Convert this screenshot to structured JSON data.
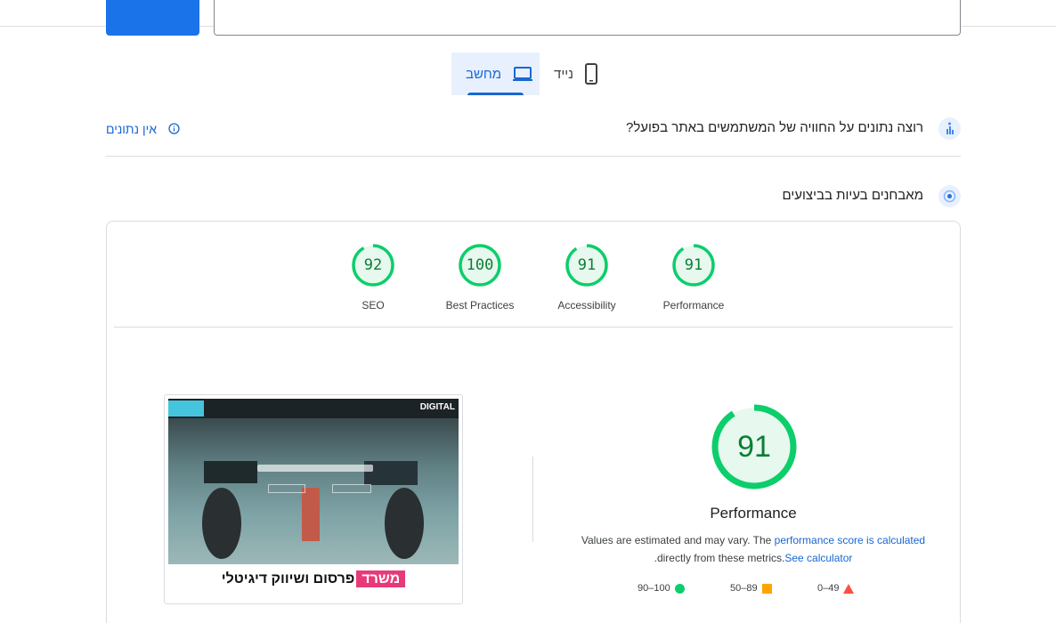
{
  "tabs": [
    {
      "label": "מחשב",
      "icon": "laptop-icon",
      "active": true
    },
    {
      "label": "נייד",
      "icon": "phone-icon",
      "active": false
    }
  ],
  "crux": {
    "question": "רוצה נתונים על החוויה של המשתמשים באתר בפועל?",
    "no_data": "אין נתונים"
  },
  "diagnose": {
    "title": "מאבחנים בעיות בביצועים"
  },
  "gauges": [
    {
      "score": 91,
      "label": "Performance"
    },
    {
      "score": 91,
      "label": "Accessibility"
    },
    {
      "score": 100,
      "label": "Best Practices"
    },
    {
      "score": 92,
      "label": "SEO"
    }
  ],
  "screenshot": {
    "caption_tag": "משרד",
    "caption": "פרסום ושיווק דיגיטלי",
    "logo": "DIGITAL"
  },
  "performance": {
    "score": 91,
    "label": "Performance",
    "desc_before": "Values are estimated and may vary. The ",
    "desc_link": "performance score is calculated",
    "desc_middle": "directly from these metrics.",
    "desc_link2": "See calculator",
    "desc_end": "."
  },
  "legend": {
    "fail": "0–49",
    "average": "50–89",
    "pass": "90–100"
  },
  "colors": {
    "pass": "#0cce6b",
    "average": "#ffa400",
    "fail": "#ff4e42",
    "accent": "#1967d2"
  }
}
